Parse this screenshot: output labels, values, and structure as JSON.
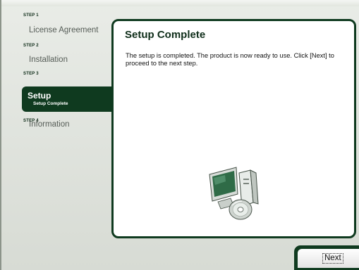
{
  "sidebar": {
    "steps": [
      {
        "step": "STEP 1",
        "label": "License Agreement"
      },
      {
        "step": "STEP 2",
        "label": "Installation"
      },
      {
        "step": "STEP 3",
        "label": "Setup",
        "sublabel": "Setup Complete",
        "active": true
      },
      {
        "step": "STEP 4",
        "label": "Information"
      }
    ]
  },
  "panel": {
    "title": "Setup Complete",
    "body": "The setup is completed. The product is now ready to use. Click [Next] to proceed to the next step.",
    "illustration": "computer-with-disc-icon"
  },
  "footer": {
    "next_label": "Next"
  },
  "colors": {
    "accent": "#0f3a1f",
    "background": "#e3e7e0",
    "panel": "#ffffff"
  }
}
